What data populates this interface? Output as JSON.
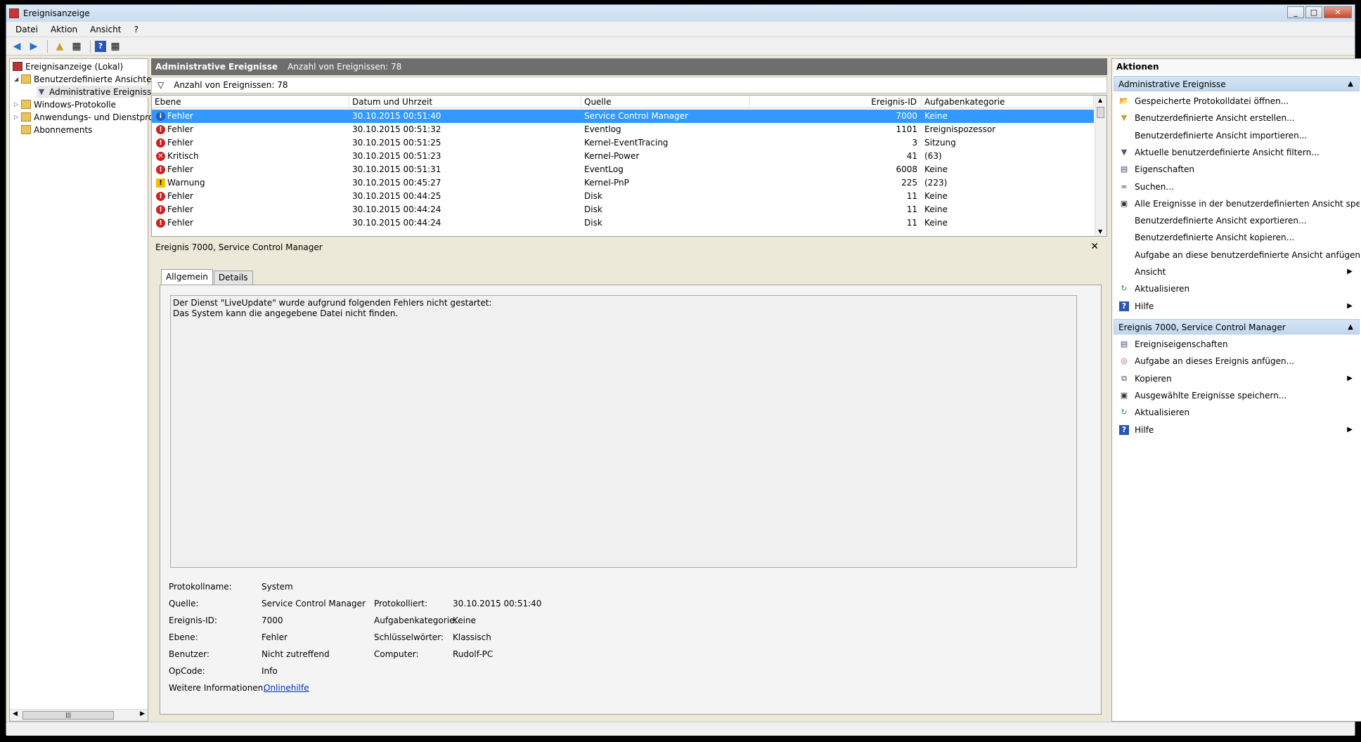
{
  "window": {
    "title": "Ereignisanzeige"
  },
  "menu": [
    "Datei",
    "Aktion",
    "Ansicht",
    "?"
  ],
  "tree": {
    "root": "Ereignisanzeige (Lokal)",
    "custom_views": "Benutzerdefinierte Ansichten",
    "admin_events": "Administrative Ereignisse",
    "windows_logs": "Windows-Protokolle",
    "app_logs": "Anwendungs- und Dienstprotokolle",
    "subscriptions": "Abonnements"
  },
  "center": {
    "header_title": "Administrative Ereignisse",
    "header_count": "Anzahl von Ereignissen: 78",
    "filter_text": "Anzahl von Ereignissen: 78",
    "columns": [
      "Ebene",
      "Datum und Uhrzeit",
      "Quelle",
      "Ereignis-ID",
      "Aufgabenkategorie"
    ],
    "rows": [
      {
        "level": "Fehler",
        "icon": "error-icon",
        "date": "30.10.2015 00:51:40",
        "source": "Service Control Manager",
        "id": "7000",
        "category": "Keine"
      },
      {
        "level": "Fehler",
        "icon": "error-icon",
        "date": "30.10.2015 00:51:32",
        "source": "Eventlog",
        "id": "1101",
        "category": "Ereignispozessor"
      },
      {
        "level": "Fehler",
        "icon": "error-icon",
        "date": "30.10.2015 00:51:25",
        "source": "Kernel-EventTracing",
        "id": "3",
        "category": "Sitzung"
      },
      {
        "level": "Kritisch",
        "icon": "critical-icon",
        "date": "30.10.2015 00:51:23",
        "source": "Kernel-Power",
        "id": "41",
        "category": "(63)"
      },
      {
        "level": "Fehler",
        "icon": "error-icon",
        "date": "30.10.2015 00:51:31",
        "source": "EventLog",
        "id": "6008",
        "category": "Keine"
      },
      {
        "level": "Warnung",
        "icon": "warning-icon",
        "date": "30.10.2015 00:45:27",
        "source": "Kernel-PnP",
        "id": "225",
        "category": "(223)"
      },
      {
        "level": "Fehler",
        "icon": "error-icon",
        "date": "30.10.2015 00:44:25",
        "source": "Disk",
        "id": "11",
        "category": "Keine"
      },
      {
        "level": "Fehler",
        "icon": "error-icon",
        "date": "30.10.2015 00:44:24",
        "source": "Disk",
        "id": "11",
        "category": "Keine"
      },
      {
        "level": "Fehler",
        "icon": "error-icon",
        "date": "30.10.2015 00:44:24",
        "source": "Disk",
        "id": "11",
        "category": "Keine"
      }
    ],
    "detail_title": "Ereignis 7000, Service Control Manager",
    "tabs": [
      "Allgemein",
      "Details"
    ],
    "message_line1": "Der Dienst \"LiveUpdate\" wurde aufgrund folgenden Fehlers nicht gestartet:",
    "message_line2": "Das System kann die angegebene Datei nicht finden.",
    "props": {
      "log_label": "Protokollname:",
      "log_value": "System",
      "source_label": "Quelle:",
      "source_value": "Service Control Manager",
      "logged_label": "Protokolliert:",
      "logged_value": "30.10.2015 00:51:40",
      "id_label": "Ereignis-ID:",
      "id_value": "7000",
      "category_label": "Aufgabenkategorie:",
      "category_value": "Keine",
      "level_label": "Ebene:",
      "level_value": "Fehler",
      "keywords_label": "Schlüsselwörter:",
      "keywords_value": "Klassisch",
      "user_label": "Benutzer:",
      "user_value": "Nicht zutreffend",
      "computer_label": "Computer:",
      "computer_value": "Rudolf-PC",
      "opcode_label": "OpCode:",
      "opcode_value": "Info",
      "more_label": "Weitere Informationen:",
      "more_value": "Onlinehilfe"
    }
  },
  "actions": {
    "title": "Aktionen",
    "section1": "Administrative Ereignisse",
    "items1": [
      {
        "label": "Gespeicherte Protokolldatei öffnen...",
        "icon": "folder-open-icon"
      },
      {
        "label": "Benutzerdefinierte Ansicht erstellen...",
        "icon": "filter-create-icon"
      },
      {
        "label": "Benutzerdefinierte Ansicht importieren...",
        "icon": ""
      },
      {
        "label": "Aktuelle benutzerdefinierte Ansicht filtern...",
        "icon": "filter-icon"
      },
      {
        "label": "Eigenschaften",
        "icon": "properties-icon"
      },
      {
        "label": "Suchen...",
        "icon": "binoculars-icon"
      },
      {
        "label": "Alle Ereignisse in der benutzerdefinierten Ansicht speic...",
        "icon": "save-icon"
      },
      {
        "label": "Benutzerdefinierte Ansicht exportieren...",
        "icon": ""
      },
      {
        "label": "Benutzerdefinierte Ansicht kopieren...",
        "icon": ""
      },
      {
        "label": "Aufgabe an diese benutzerdefinierte Ansicht anfügen...",
        "icon": ""
      },
      {
        "label": "Ansicht",
        "icon": "",
        "submenu": true
      },
      {
        "label": "Aktualisieren",
        "icon": "refresh-icon"
      },
      {
        "label": "Hilfe",
        "icon": "help-icon",
        "submenu": true
      }
    ],
    "section2": "Ereignis 7000, Service Control Manager",
    "items2": [
      {
        "label": "Ereigniseigenschaften",
        "icon": "event-properties-icon"
      },
      {
        "label": "Aufgabe an dieses Ereignis anfügen...",
        "icon": "task-icon"
      },
      {
        "label": "Kopieren",
        "icon": "copy-icon",
        "submenu": true
      },
      {
        "label": "Ausgewählte Ereignisse speichern...",
        "icon": "save-icon"
      },
      {
        "label": "Aktualisieren",
        "icon": "refresh-icon"
      },
      {
        "label": "Hilfe",
        "icon": "help-icon",
        "submenu": true
      }
    ]
  },
  "colors": {
    "selection": "#3399ff",
    "error": "#cc2222",
    "warning": "#f0c000",
    "header": "#6e6e6e",
    "link": "#0033cc"
  }
}
